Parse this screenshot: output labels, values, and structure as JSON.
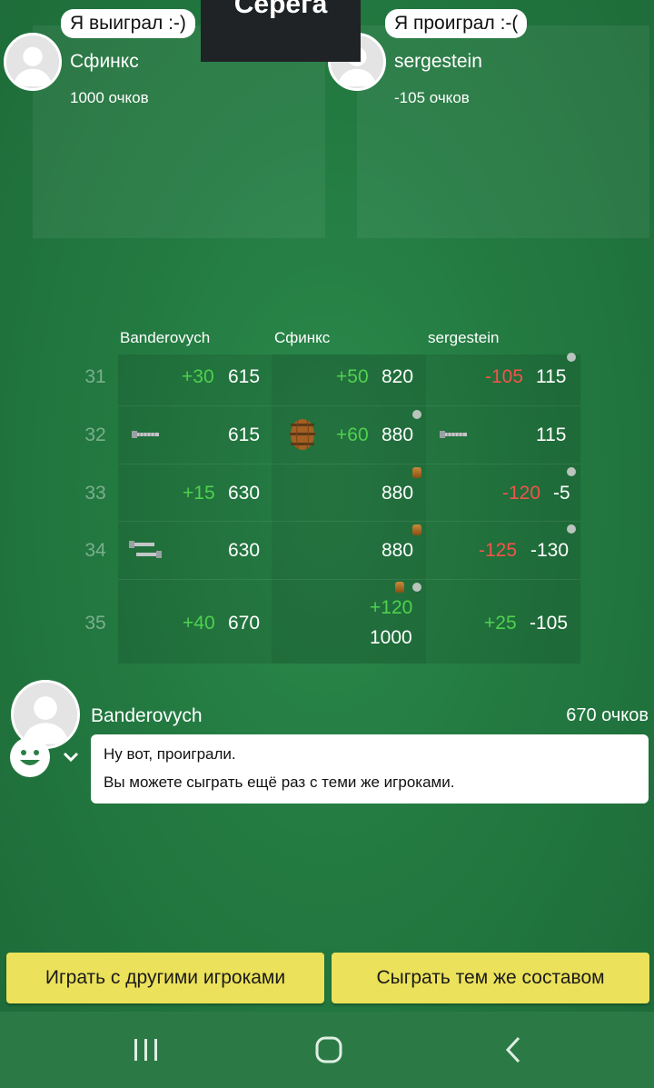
{
  "title": "Серега",
  "top_players": [
    {
      "bubble": "Я выиграл :-)",
      "name": "Сфинкс",
      "score": "1000 очков"
    },
    {
      "bubble": "Я проиграл :-(",
      "name": "sergestein",
      "score": "-105 очков"
    }
  ],
  "table": {
    "headers": [
      "Banderovych",
      "Сфинкс",
      "sergestein"
    ],
    "rows": [
      {
        "num": "31",
        "c1_delta": "+30",
        "c1_total": "615",
        "c2_delta": "+50",
        "c2_total": "820",
        "c3_delta": "-105",
        "c3_total": "115"
      },
      {
        "num": "32",
        "c1_delta": "",
        "c1_total": "615",
        "c2_delta": "+60",
        "c2_total": "880",
        "c3_delta": "",
        "c3_total": "115"
      },
      {
        "num": "33",
        "c1_delta": "+15",
        "c1_total": "630",
        "c2_delta": "",
        "c2_total": "880",
        "c3_delta": "-120",
        "c3_total": "-5"
      },
      {
        "num": "34",
        "c1_delta": "",
        "c1_total": "630",
        "c2_delta": "",
        "c2_total": "880",
        "c3_delta": "-125",
        "c3_total": "-130"
      },
      {
        "num": "35",
        "c1_delta": "+40",
        "c1_total": "670",
        "c2_delta": "+120",
        "c2_total": "1000",
        "c3_delta": "+25",
        "c3_total": "-105"
      }
    ]
  },
  "chat": {
    "name": "Banderovych",
    "score": "670 очков",
    "line1": "Ну вот, проиграли.",
    "line2": "Вы можете сыграть ещё раз с теми же игроками."
  },
  "buttons": {
    "other_players": "Играть с другими игроками",
    "same_team": "Сыграть тем же составом"
  },
  "colors": {
    "positive": "#4fd14f",
    "negative": "#f2544a",
    "button": "#ebe15a"
  },
  "icons": [
    "bolt-icon",
    "barrel-icon",
    "smiley-icon",
    "chevron-down-icon",
    "recent-apps-icon",
    "home-icon",
    "back-icon"
  ]
}
